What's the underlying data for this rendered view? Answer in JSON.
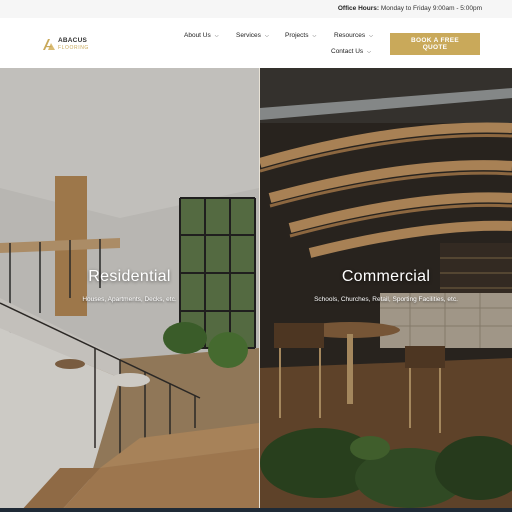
{
  "topbar": {
    "office_label": "Office Hours:",
    "office_hours": "Monday to Friday 9:00am - 5:00pm"
  },
  "brand": {
    "name": "ABACUS",
    "tagline": "FLOORING",
    "accent": "#c9a95a"
  },
  "nav": {
    "items": [
      {
        "label": "About Us",
        "icon": "chevron-down-icon"
      },
      {
        "label": "Services",
        "icon": "chevron-down-icon"
      },
      {
        "label": "Projects",
        "icon": "chevron-down-icon"
      },
      {
        "label": "Resources",
        "icon": "chevron-down-icon"
      },
      {
        "label": "Contact Us",
        "icon": "chevron-down-icon"
      }
    ],
    "cta_line1": "BOOK A FREE",
    "cta_line2": "QUOTE"
  },
  "hero": {
    "left": {
      "title": "Residential",
      "subtitle": "Houses, Apartments, Decks, etc."
    },
    "right": {
      "title": "Commercial",
      "subtitle": "Schools, Churches, Retail, Sporting Facilities, etc."
    }
  },
  "colors": {
    "accent": "#c9a95a",
    "footer_strip": "#1f2a36"
  }
}
